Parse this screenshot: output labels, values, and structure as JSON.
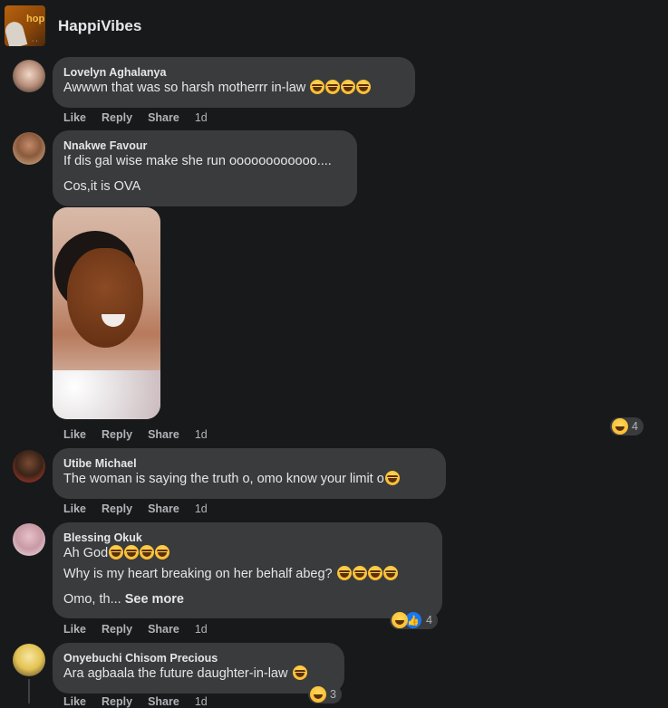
{
  "page": {
    "name": "HappiVibes",
    "logo_text": "hop",
    "logo_dots": "· ·"
  },
  "actions": {
    "like": "Like",
    "reply": "Reply",
    "share": "Share"
  },
  "comments": [
    {
      "author": "Lovelyn Aghalanya",
      "text": "Awwwn that was so harsh motherrr in-law",
      "emoji_count": 4,
      "time": "1d"
    },
    {
      "author": "Nnakwe Favour",
      "line1": "If dis gal wise make she run oooooooooooo....",
      "line2": "Cos,it is OVA",
      "time": "1d",
      "reaction_count": "4",
      "reaction_type": "haha"
    },
    {
      "author": "Utibe Michael",
      "text": "The woman is saying the truth o, omo know your limit o",
      "time": "1d"
    },
    {
      "author": "Blessing Okuk",
      "line1": "Ah God",
      "line2": "Why is my heart breaking on her behalf abeg?",
      "line3": "Omo, th...",
      "see_more": "See more",
      "time": "1d",
      "reaction_count": "4"
    },
    {
      "author": "Onyebuchi Chisom Precious",
      "text": "Ara agbaala the future daughter-in-law",
      "time": "1d",
      "reaction_count": "3"
    }
  ]
}
